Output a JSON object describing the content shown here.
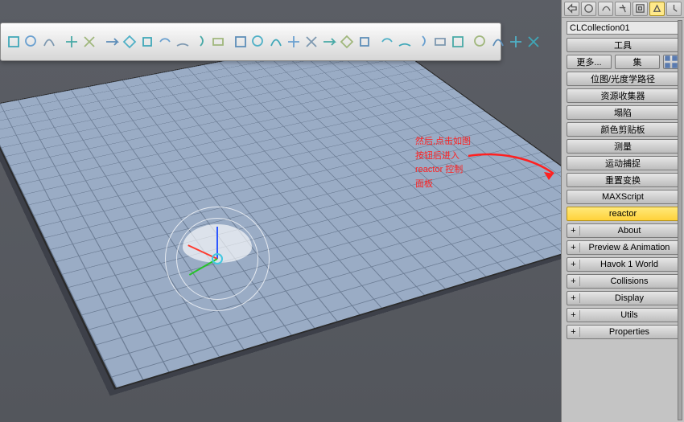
{
  "toolbar_icons": [
    "select-icon",
    "link-icon",
    "layers-icon",
    "stack-icon",
    "snap-icon",
    "spline-icon",
    "magnify-icon",
    "gear-icon",
    "atom-icon",
    "path-icon",
    "constraint-icon",
    "wave-icon",
    "circle-icon",
    "spring-icon",
    "figure-icon",
    "plane-icon",
    "box-icon",
    "helix-icon",
    "cloth-icon",
    "utility-icon",
    "material-icon",
    "grab-icon",
    "settings-icon",
    "wind-icon",
    "water-icon",
    "render-icon",
    "camera-icon",
    "preview-icon",
    "record-icon"
  ],
  "object_name": "CLCollection01",
  "panel": {
    "tools_header": "工具",
    "more": "更多...",
    "set": "集",
    "utilities": [
      "位图/光度学路径",
      "资源收集器",
      "塌陷",
      "颜色剪贴板",
      "测量",
      "运动捕捉",
      "重置变换",
      "MAXScript",
      "reactor"
    ],
    "rollouts": [
      "About",
      "Preview & Animation",
      "Havok 1 World",
      "Collisions",
      "Display",
      "Utils",
      "Properties"
    ]
  },
  "annotation": {
    "line1": "然后,点击如图",
    "line2": "按钮后进入",
    "line3": "reactor 控制",
    "line4": "面板"
  },
  "tab_icons": [
    "arrow-icon",
    "sphere-icon",
    "arc-icon",
    "motion-icon",
    "display-icon",
    "hammer-icon",
    "pin-icon"
  ],
  "close_glyph": "✕",
  "plus_glyph": "+"
}
